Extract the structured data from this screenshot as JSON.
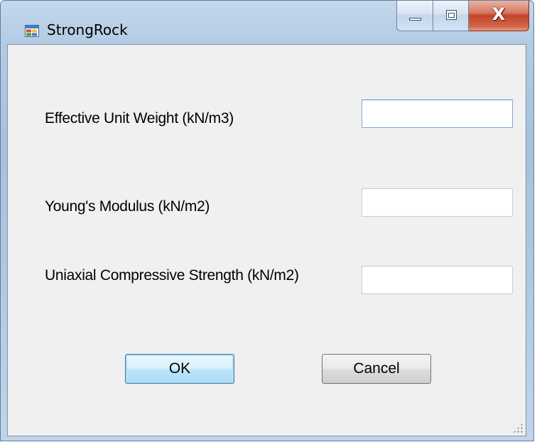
{
  "window": {
    "title": "StrongRock",
    "icon": "application-window-icon",
    "controls": {
      "minimize": "minimize-icon",
      "maximize": "maximize-icon",
      "close": "close-icon",
      "close_glyph": "X"
    }
  },
  "form": {
    "fields": [
      {
        "label": "Effective Unit Weight (kN/m3)",
        "value": "",
        "focused": true
      },
      {
        "label": "Young's Modulus (kN/m2)",
        "value": ""
      },
      {
        "label": "Uniaxial Compressive Strength (kN/m2)",
        "value": ""
      }
    ],
    "ok_label": "OK",
    "cancel_label": "Cancel"
  },
  "colors": {
    "frame": "#b3cbe4",
    "client_bg": "#f0f0f0",
    "close_button": "#c2452a",
    "default_button_border": "#3c7fb1"
  }
}
